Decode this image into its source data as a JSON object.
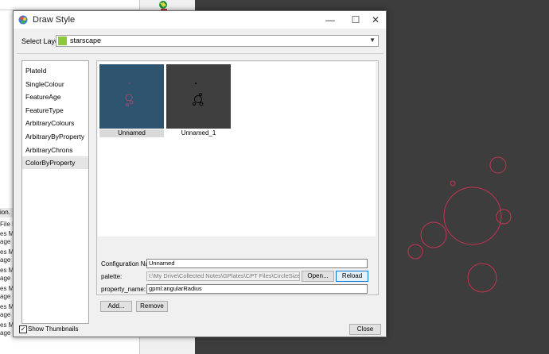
{
  "window": {
    "title": "Draw Style",
    "minimize": "—",
    "maximize": "☐",
    "close": "✕"
  },
  "select_layer": {
    "label": "Select Layer:",
    "value": "starscape",
    "swatch_color": "#8dc63f"
  },
  "style_list": {
    "items": [
      "PlateId",
      "SingleColour",
      "FeatureAge",
      "FeatureType",
      "ArbitraryColours",
      "ArbitraryByProperty",
      "ArbitraryChrons",
      "ColorByProperty"
    ],
    "selected": "ColorByProperty"
  },
  "thumbnails": [
    {
      "caption": "Unnamed",
      "selected": true,
      "background": "#2e5470"
    },
    {
      "caption": "Unnamed_1",
      "selected": false,
      "background": "#3f3f3f"
    }
  ],
  "config": {
    "name_label": "Configuration Name:",
    "name_value": "Unnamed",
    "palette_label": "palette:",
    "palette_value": "I:\\My Drive\\Collected Notes\\GPlates\\CPT Files\\CircleSize.cpt",
    "open_button": "Open...",
    "reload_button": "Reload",
    "property_label": "property_name:",
    "property_value": "gpml:angularRadius"
  },
  "buttons": {
    "add": "Add...",
    "remove": "Remove",
    "close": "Close"
  },
  "show_thumbnails": {
    "label": "Show Thumbnails",
    "checked": true,
    "mark": "✓"
  },
  "background_left": {
    "header": "ion.",
    "lines": [
      "File Fo",
      "es Mar",
      "age",
      "es Mar",
      "age",
      "es Mar",
      "age",
      "es Mar",
      "age",
      "es Mar",
      "age",
      "es Mar",
      "age"
    ]
  },
  "colors": {
    "accent": "#0078d7",
    "circle_stroke": "#c8344f",
    "canvas_background": "#3d3d3d"
  }
}
